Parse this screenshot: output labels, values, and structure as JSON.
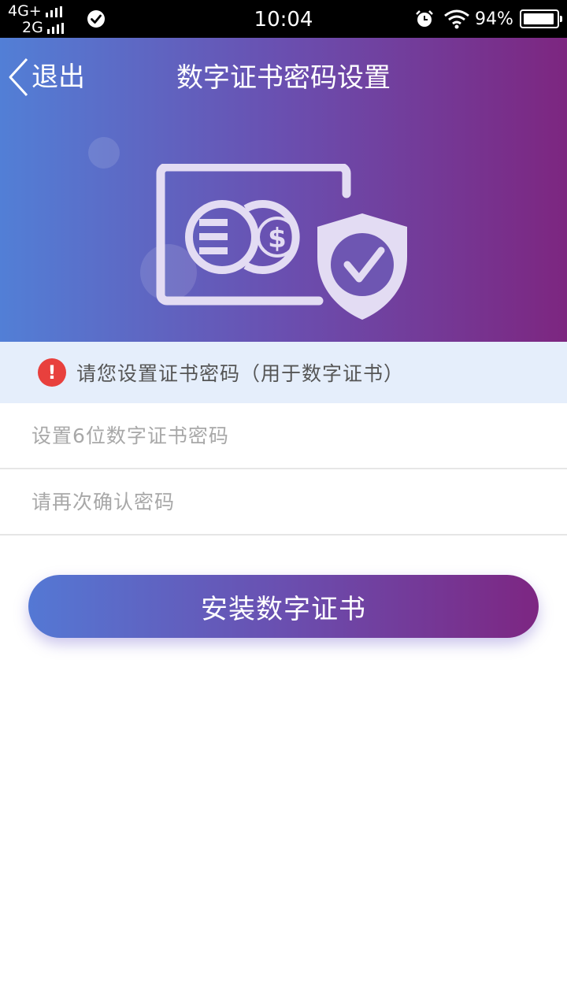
{
  "status_bar": {
    "network_1": "4G+",
    "network_2": "2G",
    "time": "10:04",
    "battery_percent": "94%",
    "battery_level": 0.94,
    "icons": [
      "signal-bars-icon",
      "check-circle-icon",
      "alarm-clock-icon",
      "wifi-icon",
      "battery-icon"
    ]
  },
  "header": {
    "back_label": "退出",
    "title": "数字证书密码设置",
    "gradient_colors": [
      "#527fd6",
      "#6a4fb0",
      "#7d2680"
    ],
    "illustration": "certificate-shield-icon"
  },
  "notice": {
    "icon": "exclamation-icon",
    "icon_color": "#e8403d",
    "text": "请您设置证书密码（用于数字证书）"
  },
  "form": {
    "password_placeholder": "设置6位数字证书密码",
    "confirm_placeholder": "请再次确认密码"
  },
  "install_button": {
    "label": "安装数字证书"
  }
}
